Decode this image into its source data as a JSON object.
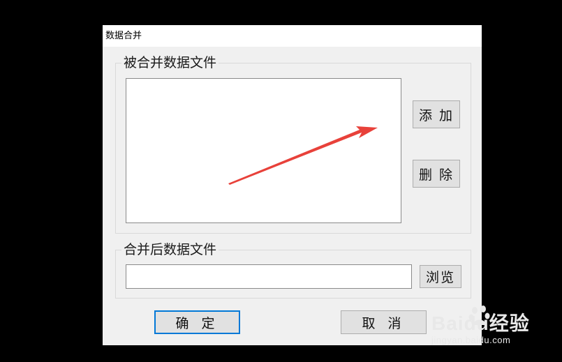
{
  "window": {
    "title": "数据合并"
  },
  "source_group": {
    "legend": "被合并数据文件",
    "add_label": "添 加",
    "delete_label": "删 除"
  },
  "output_group": {
    "legend": "合并后数据文件",
    "path_value": "",
    "browse_label": "浏览"
  },
  "actions": {
    "ok_label": "确 定",
    "cancel_label": "取 消"
  },
  "annotation": {
    "arrow_color": "#e8413a",
    "points_to": "add-button"
  },
  "watermark": {
    "brand": "Baidu经验",
    "url": "jingyan.baidu.com"
  }
}
